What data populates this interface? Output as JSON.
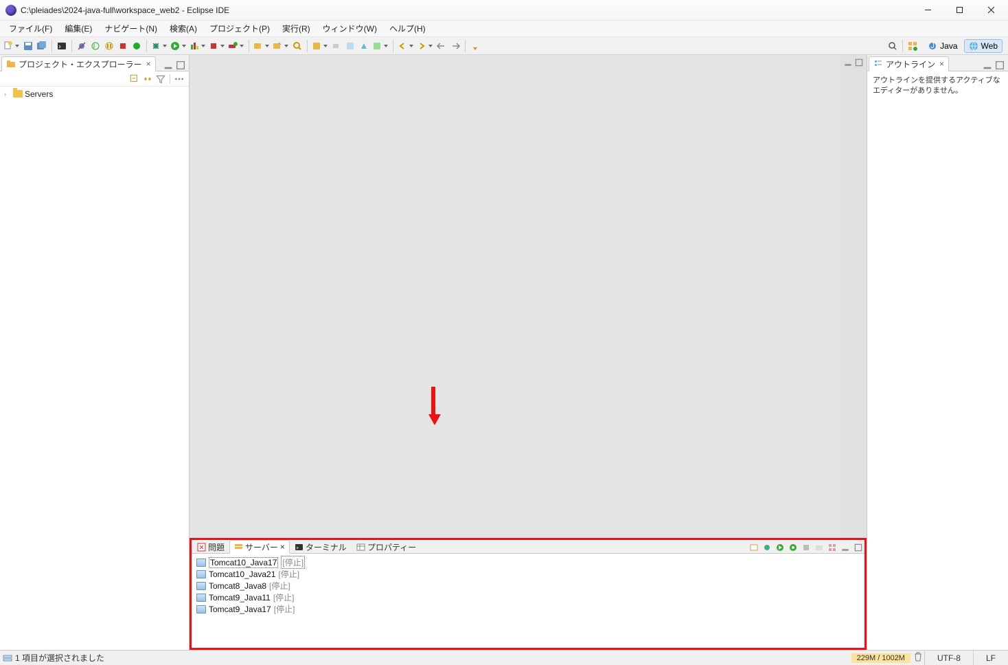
{
  "window": {
    "title": "C:\\pleiades\\2024-java-full\\workspace_web2 - Eclipse IDE"
  },
  "menus": {
    "file": "ファイル(F)",
    "edit": "編集(E)",
    "navigate": "ナビゲート(N)",
    "search": "検索(A)",
    "project": "プロジェクト(P)",
    "run": "実行(R)",
    "window": "ウィンドウ(W)",
    "help": "ヘルプ(H)"
  },
  "perspectives": {
    "java": "Java",
    "web": "Web"
  },
  "project_explorer": {
    "title": "プロジェクト・エクスプローラー",
    "items": [
      {
        "label": "Servers"
      }
    ]
  },
  "outline": {
    "title": "アウトライン",
    "empty_msg": "アウトラインを提供するアクティブなエディターがありません。"
  },
  "bottom_tabs": {
    "problems": "問題",
    "servers": "サーバー",
    "terminal": "ターミナル",
    "properties": "プロパティー"
  },
  "servers": [
    {
      "name": "Tomcat10_Java17",
      "status": "[停止]",
      "selected": true
    },
    {
      "name": "Tomcat10_Java21",
      "status": "[停止]",
      "selected": false
    },
    {
      "name": "Tomcat8_Java8",
      "status": "[停止]",
      "selected": false
    },
    {
      "name": "Tomcat9_Java11",
      "status": "[停止]",
      "selected": false
    },
    {
      "name": "Tomcat9_Java17",
      "status": "[停止]",
      "selected": false
    }
  ],
  "statusbar": {
    "selection": "1 項目が選択されました",
    "heap": "229M / 1002M",
    "encoding": "UTF-8",
    "lineend": "LF"
  }
}
